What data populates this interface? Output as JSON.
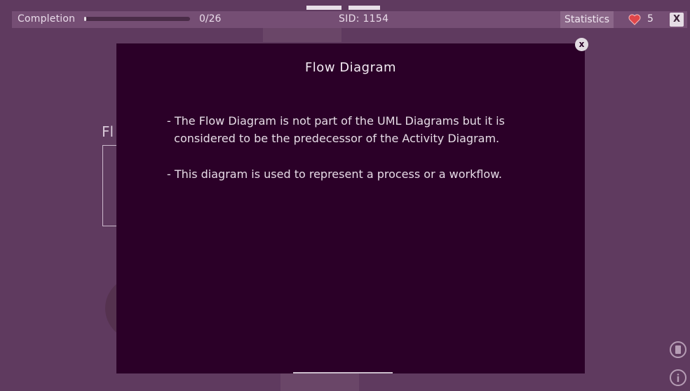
{
  "topbar": {
    "completion_label": "Completion",
    "progress_text": "0/26",
    "progress_fraction": 0.01,
    "sid": "SID: 1154",
    "statistics_label": "Statistics",
    "lives": "5",
    "close_label": "X"
  },
  "background": {
    "partial_title": "Fl"
  },
  "modal": {
    "title": "Flow Diagram",
    "close_label": "x",
    "lines": [
      "- The Flow Diagram is not part of the UML Diagrams but it is",
      "  considered to be the predecessor of the Activity Diagram.",
      "- This diagram is used to represent a process or a workflow."
    ]
  },
  "icons": {
    "heart": "heart-icon",
    "notes": "notes-icon",
    "info": "info-icon"
  },
  "colors": {
    "background": "#5f3a5f",
    "modal": "#2b0028",
    "accent_heart": "#e0464a"
  }
}
